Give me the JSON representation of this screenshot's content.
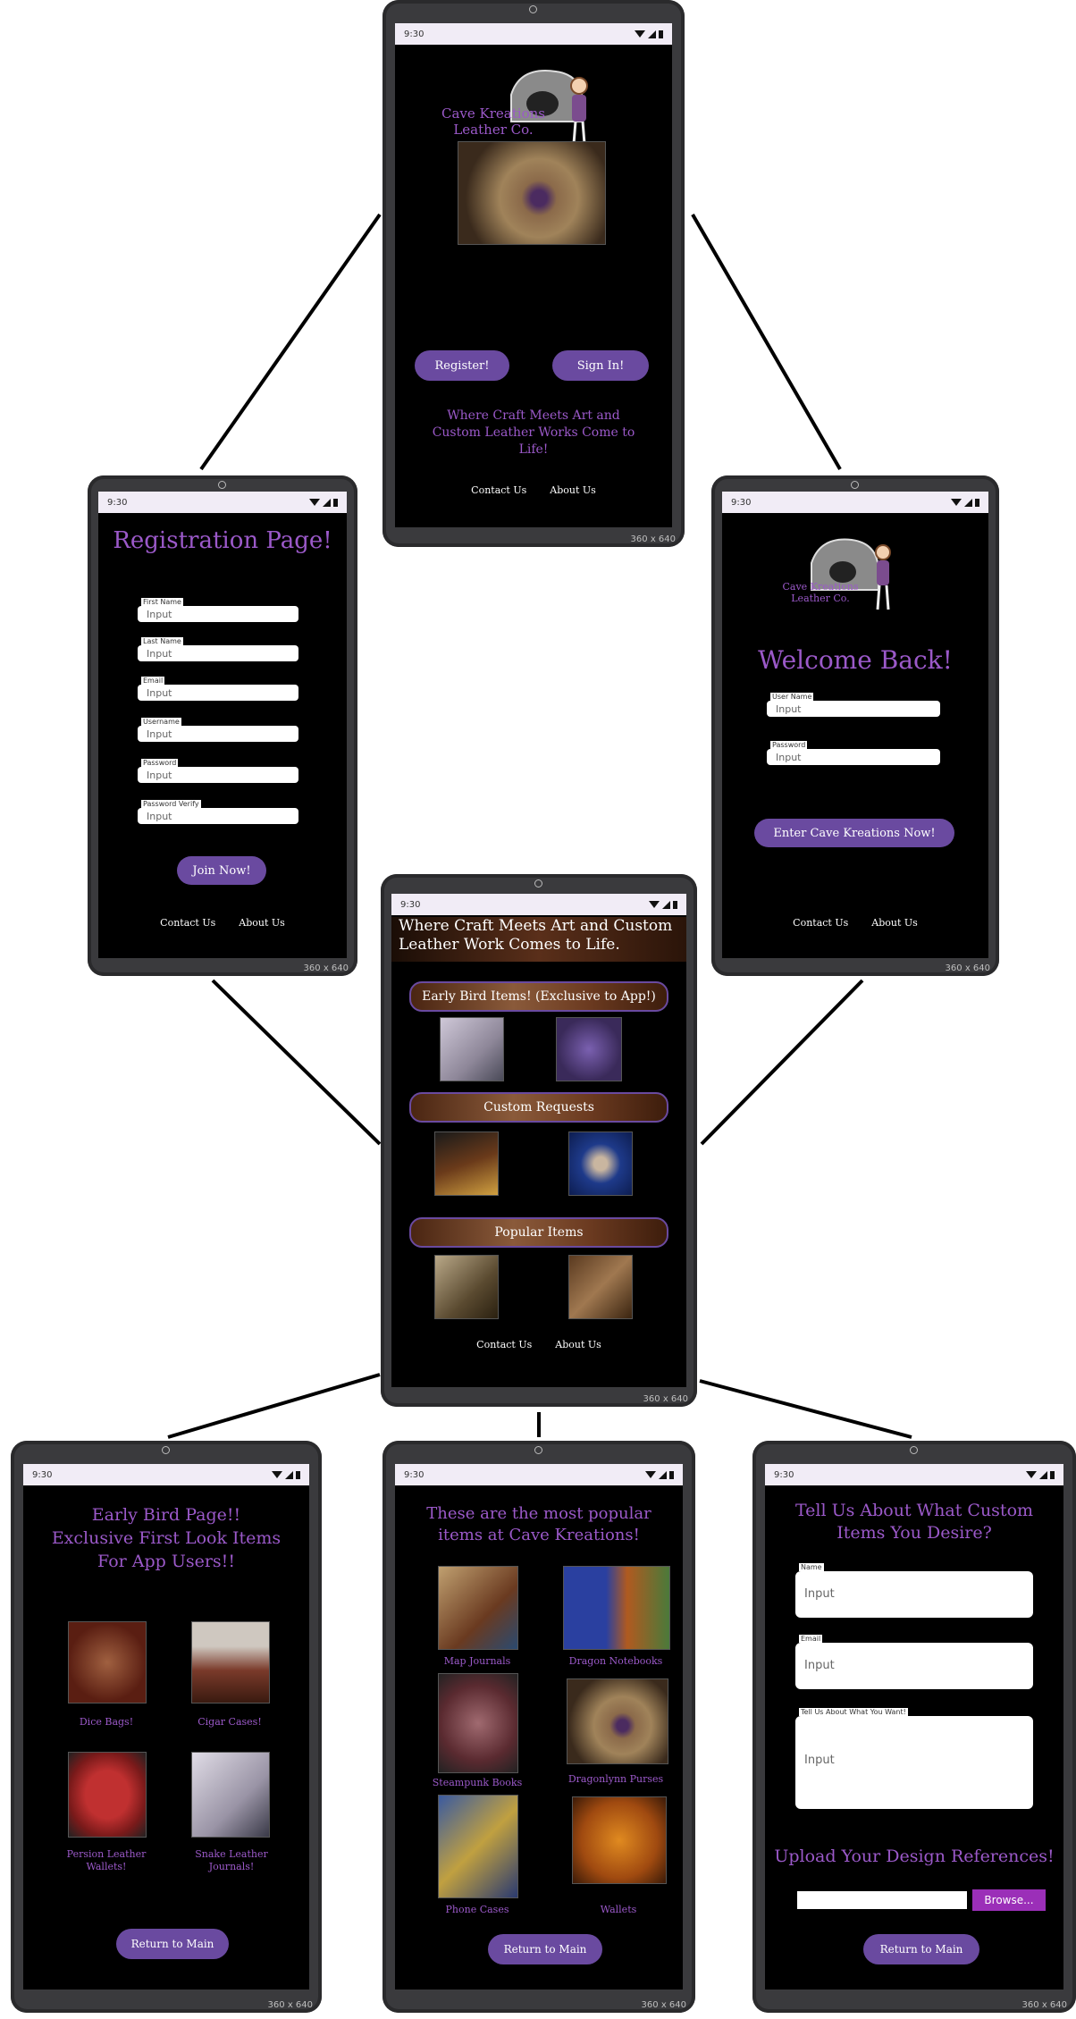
{
  "status_time": "9:30",
  "screen_size": "360 x 640",
  "brand": {
    "logo_text": "Cave Kreations\nLeather Co."
  },
  "home": {
    "register_label": "Register!",
    "signin_label": "Sign In!",
    "tagline": "Where Craft Meets Art and Custom Leather Works Come to Life!",
    "contact_label": "Contact Us",
    "about_label": "About Us"
  },
  "registration": {
    "title": "Registration Page!",
    "fields": [
      {
        "label": "First Name",
        "placeholder": "Input"
      },
      {
        "label": "Last Name",
        "placeholder": "Input"
      },
      {
        "label": "Email",
        "placeholder": "Input"
      },
      {
        "label": "Username",
        "placeholder": "Input"
      },
      {
        "label": "Password",
        "placeholder": "Input"
      },
      {
        "label": "Password Verify",
        "placeholder": "Input"
      }
    ],
    "join_label": "Join Now!",
    "contact_label": "Contact Us",
    "about_label": "About Us"
  },
  "signin": {
    "logo_text": "Cave Kreations\nLeather Co.",
    "title": "Welcome Back!",
    "fields": [
      {
        "label": "User Name",
        "placeholder": "Input"
      },
      {
        "label": "Password",
        "placeholder": "Input"
      }
    ],
    "enter_label": "Enter Cave Kreations Now!",
    "contact_label": "Contact Us",
    "about_label": "About Us"
  },
  "main": {
    "header": "Where Craft Meets Art and Custom Leather Work Comes to Life.",
    "early_bird_banner": "Early Bird Items! (Exclusive to App!)",
    "custom_banner": "Custom Requests",
    "popular_banner": "Popular Items",
    "contact_label": "Contact Us",
    "about_label": "About Us"
  },
  "early_bird": {
    "title": "Early Bird Page!!\nExclusive First Look Items\nFor App Users!!",
    "items": [
      "Dice Bags!",
      "Cigar Cases!",
      "Persion Leather\nWallets!",
      "Snake Leather\nJournals!"
    ],
    "return_label": "Return to Main"
  },
  "popular": {
    "title": "These are the most popular\nitems at Cave Kreations!",
    "items": [
      "Map Journals",
      "Dragon Notebooks",
      "Steampunk Books",
      "Dragonlynn Purses",
      "Phone Cases",
      "Wallets"
    ],
    "return_label": "Return to Main"
  },
  "custom": {
    "title": "Tell Us About What Custom\nItems You Desire?",
    "fields": [
      {
        "label": "Name",
        "placeholder": "Input"
      },
      {
        "label": "Email",
        "placeholder": "Input"
      },
      {
        "label": "Tell Us About What You Want!",
        "placeholder": "Input"
      }
    ],
    "upload_title": "Upload Your Design References!",
    "browse_label": "Browse...",
    "return_label": "Return to Main"
  },
  "colors": {
    "accent": "#6a4aa0",
    "title_purple": "#9b59c9",
    "screen_bg": "#000000"
  }
}
